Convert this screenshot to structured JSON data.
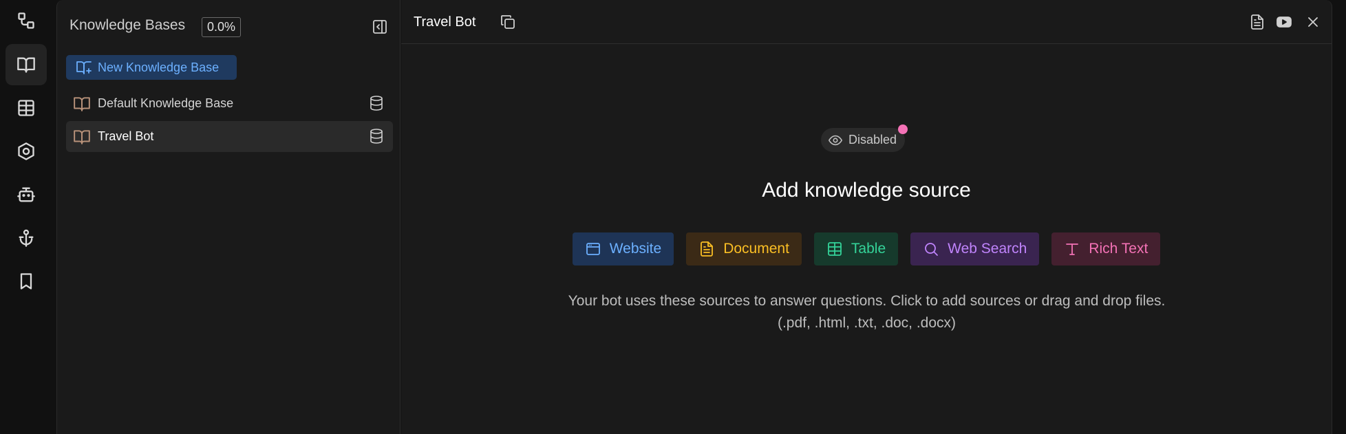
{
  "colors": {
    "website": "#6cb0ff",
    "website_bg": "#1e3456",
    "document": "#fbbf24",
    "document_bg": "#3b2a16",
    "table": "#34d399",
    "table_bg": "#163a2c",
    "web_search": "#c084fc",
    "web_search_bg": "#3a2450",
    "rich_text": "#f472b6",
    "rich_text_bg": "#44202f",
    "status_dot": "#f472b6"
  },
  "rail": {
    "icons": [
      "workflow-icon",
      "book-icon",
      "table-icon",
      "hexagon-icon",
      "bot-icon",
      "anchor-icon",
      "bookmark-icon"
    ],
    "active": "book-icon"
  },
  "kb_panel": {
    "title": "Knowledge Bases",
    "usage": "0.0%",
    "new_button": "New Knowledge Base",
    "items": [
      {
        "label": "Default Knowledge Base"
      },
      {
        "label": "Travel Bot",
        "selected": true
      }
    ]
  },
  "main": {
    "title": "Travel Bot",
    "status": "Disabled",
    "heading": "Add knowledge source",
    "sources": [
      {
        "label": "Website",
        "icon": "browser-window-icon"
      },
      {
        "label": "Document",
        "icon": "document-icon"
      },
      {
        "label": "Table",
        "icon": "table-icon"
      },
      {
        "label": "Web Search",
        "icon": "search-icon"
      },
      {
        "label": "Rich Text",
        "icon": "text-icon"
      }
    ],
    "help": "Your bot uses these sources to answer questions. Click to add sources or drag and drop files. (.pdf, .html, .txt, .doc, .docx)"
  }
}
